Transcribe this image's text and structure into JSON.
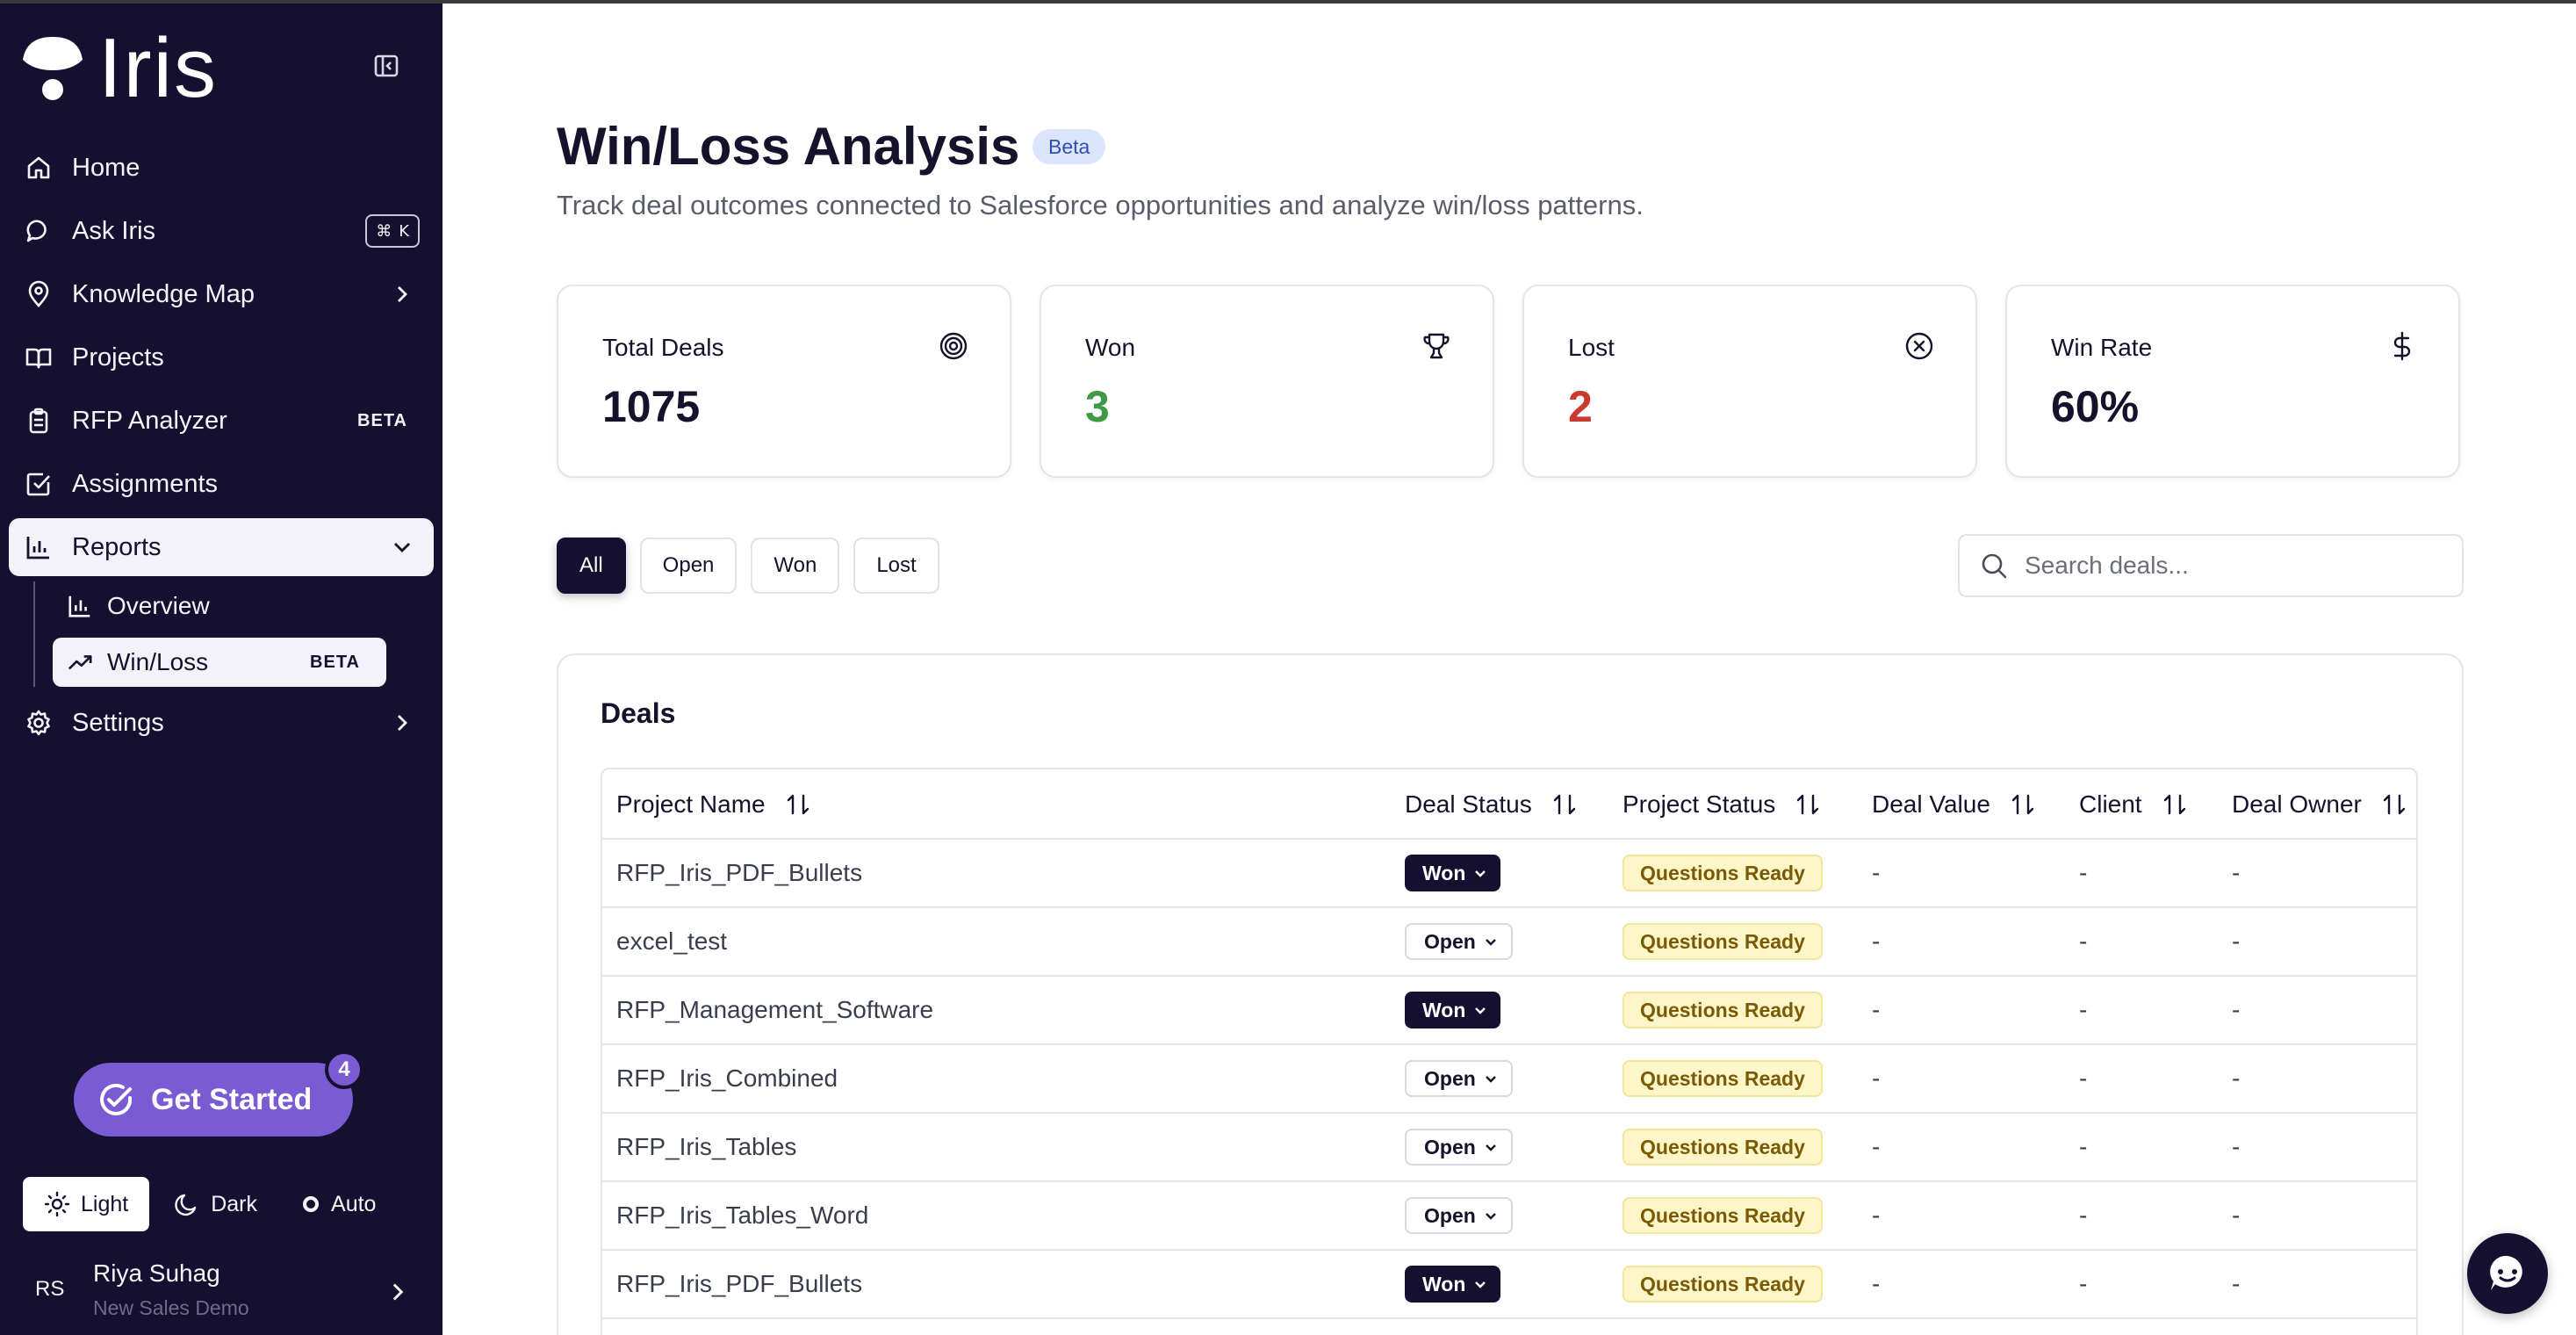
{
  "app": {
    "logo_text": "Iris"
  },
  "sidebar": {
    "items": [
      {
        "label": "Home",
        "icon": "home-icon"
      },
      {
        "label": "Ask Iris",
        "icon": "chat-icon",
        "shortcut_symbol": "⌘",
        "shortcut_key": "K"
      },
      {
        "label": "Knowledge Map",
        "icon": "map-pin-icon"
      },
      {
        "label": "Projects",
        "icon": "book-icon"
      },
      {
        "label": "RFP Analyzer",
        "icon": "clipboard-icon",
        "tag": "BETA"
      },
      {
        "label": "Assignments",
        "icon": "checkbox-icon"
      },
      {
        "label": "Reports",
        "icon": "bar-chart-icon"
      },
      {
        "label": "Settings",
        "icon": "gear-icon"
      }
    ],
    "reports_sub": [
      {
        "label": "Overview",
        "icon": "bar-chart-icon"
      },
      {
        "label": "Win/Loss",
        "icon": "trend-up-icon",
        "tag": "BETA"
      }
    ],
    "get_started": {
      "label": "Get Started",
      "badge": "4"
    },
    "theme": {
      "light": "Light",
      "dark": "Dark",
      "auto": "Auto"
    },
    "user": {
      "initials": "RS",
      "name": "Riya Suhag",
      "org": "New Sales Demo"
    }
  },
  "page": {
    "title": "Win/Loss Analysis",
    "badge": "Beta",
    "subtitle": "Track deal outcomes connected to Salesforce opportunities and analyze win/loss patterns."
  },
  "stats": [
    {
      "label": "Total Deals",
      "value": "1075",
      "color": "#15132b",
      "icon": "target-icon"
    },
    {
      "label": "Won",
      "value": "3",
      "color": "#3f9a45",
      "icon": "trophy-icon"
    },
    {
      "label": "Lost",
      "value": "2",
      "color": "#c93a30",
      "icon": "x-circle-icon"
    },
    {
      "label": "Win Rate",
      "value": "60%",
      "color": "#15132b",
      "icon": "dollar-icon"
    }
  ],
  "filters": [
    "All",
    "Open",
    "Won",
    "Lost"
  ],
  "search": {
    "placeholder": "Search deals..."
  },
  "deals": {
    "title": "Deals",
    "columns": [
      "Project Name",
      "Deal Status",
      "Project Status",
      "Deal Value",
      "Client",
      "Deal Owner"
    ],
    "rows": [
      {
        "project": "RFP_Iris_PDF_Bullets",
        "deal_status": "Won",
        "project_status": "Questions Ready",
        "deal_value": "-",
        "client": "-",
        "owner": "-"
      },
      {
        "project": "excel_test",
        "deal_status": "Open",
        "project_status": "Questions Ready",
        "deal_value": "-",
        "client": "-",
        "owner": "-"
      },
      {
        "project": "RFP_Management_Software",
        "deal_status": "Won",
        "project_status": "Questions Ready",
        "deal_value": "-",
        "client": "-",
        "owner": "-"
      },
      {
        "project": "RFP_Iris_Combined",
        "deal_status": "Open",
        "project_status": "Questions Ready",
        "deal_value": "-",
        "client": "-",
        "owner": "-"
      },
      {
        "project": "RFP_Iris_Tables",
        "deal_status": "Open",
        "project_status": "Questions Ready",
        "deal_value": "-",
        "client": "-",
        "owner": "-"
      },
      {
        "project": "RFP_Iris_Tables_Word",
        "deal_status": "Open",
        "project_status": "Questions Ready",
        "deal_value": "-",
        "client": "-",
        "owner": "-"
      },
      {
        "project": "RFP_Iris_PDF_Bullets",
        "deal_status": "Won",
        "project_status": "Questions Ready",
        "deal_value": "-",
        "client": "-",
        "owner": "-"
      }
    ]
  },
  "colors": {
    "sidebar_bg": "#15102f",
    "accent": "#7b5bd3",
    "won": "#3f9a45",
    "lost": "#c93a30"
  }
}
